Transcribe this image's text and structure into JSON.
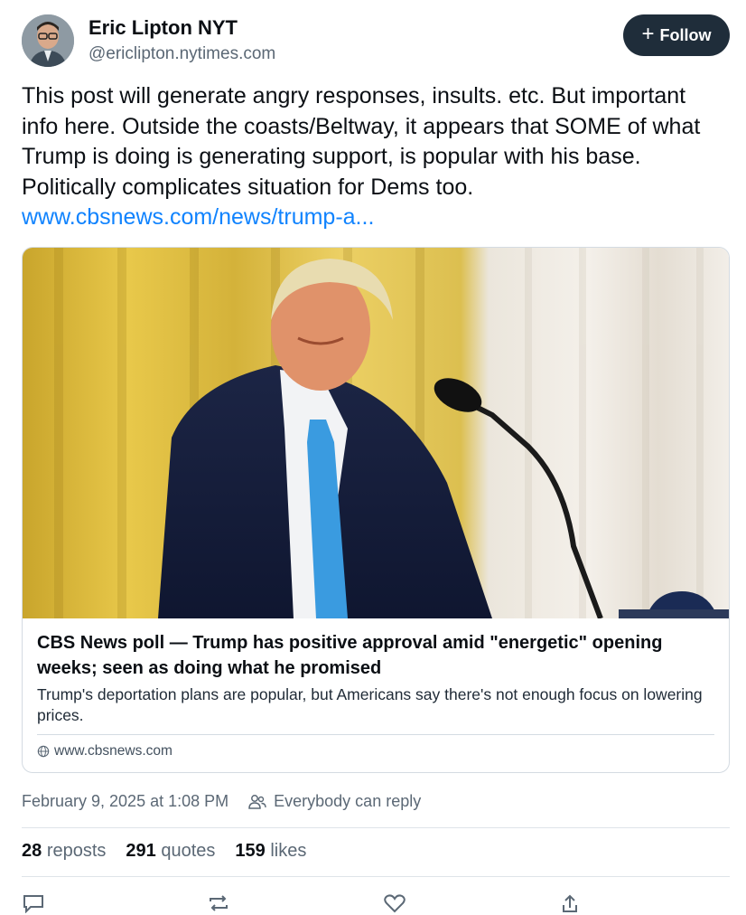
{
  "author": {
    "name": "Eric Lipton NYT",
    "handle": "@ericlipton.nytimes.com",
    "avatar_icon": "avatar"
  },
  "follow_button": {
    "label": "Follow",
    "icon": "plus-icon"
  },
  "post": {
    "text": "This post will generate angry responses, insults. etc. But important info here. Outside the coasts/Beltway, it appears that SOME of what Trump is doing is generating support, is popular with his base. Politically complicates situation for Dems too.",
    "link_text": "www.cbsnews.com/news/trump-a..."
  },
  "embed": {
    "title": "CBS News poll — Trump has positive approval amid \"energetic\" opening weeks; seen as doing what he promised",
    "description": "Trump's deportation plans are popular, but Americans say there's not enough focus on lowering prices.",
    "domain": "www.cbsnews.com",
    "domain_icon": "globe-icon"
  },
  "meta": {
    "timestamp": "February 9, 2025 at 1:08 PM",
    "reply_setting": "Everybody can reply",
    "reply_icon": "people-icon"
  },
  "stats": {
    "reposts_count": "28",
    "reposts_label": "reposts",
    "quotes_count": "291",
    "quotes_label": "quotes",
    "likes_count": "159",
    "likes_label": "likes"
  },
  "colors": {
    "accent_link": "#1083fe",
    "follow_bg": "#1f2d3a",
    "muted_text": "#5b6875"
  }
}
